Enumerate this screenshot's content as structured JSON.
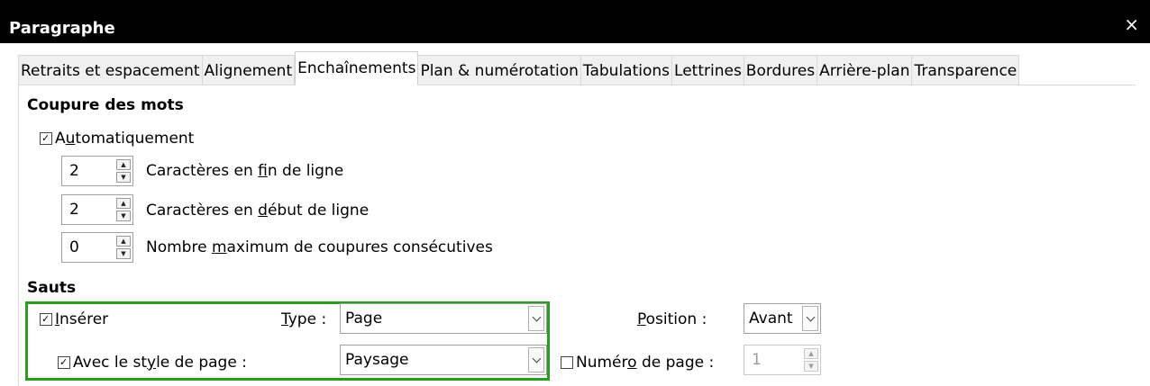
{
  "window": {
    "title": "Paragraphe",
    "close_glyph": "×"
  },
  "tabs": [
    {
      "label": "Retraits et espacement",
      "active": false
    },
    {
      "label": "Alignement",
      "active": false
    },
    {
      "label": "Enchaînements",
      "active": true
    },
    {
      "label": "Plan & numérotation",
      "active": false
    },
    {
      "label": "Tabulations",
      "active": false
    },
    {
      "label": "Lettrines",
      "active": false
    },
    {
      "label": "Bordures",
      "active": false
    },
    {
      "label": "Arrière-plan",
      "active": false
    },
    {
      "label": "Transparence",
      "active": false
    }
  ],
  "hyphenation": {
    "title": "Coupure des mots",
    "automatic": {
      "label_pre": "A",
      "label_u": "u",
      "label_post": "tomatiquement",
      "checked": true
    },
    "end_chars": {
      "value": "2",
      "label_pre": "Caractères en ",
      "label_u": "f",
      "label_post": "in de ligne"
    },
    "start_chars": {
      "value": "2",
      "label_pre": "Caractères en ",
      "label_u": "d",
      "label_post": "ébut de ligne"
    },
    "max_consecutive": {
      "value": "0",
      "label_pre": "Nombre ",
      "label_u": "m",
      "label_post": "aximum de coupures consécutives"
    }
  },
  "breaks": {
    "title": "Sauts",
    "insert": {
      "label_pre": "",
      "label_u": "I",
      "label_post": "nsérer",
      "checked": true
    },
    "type": {
      "label_u": "T",
      "label_post": "ype :",
      "value": "Page"
    },
    "position": {
      "label_u": "P",
      "label_post": "osition :",
      "value": "Avant"
    },
    "with_page_style": {
      "label_pre": "Avec le st",
      "label_u": "y",
      "label_post": "le de page :",
      "checked": true,
      "value": "Paysage"
    },
    "page_number": {
      "label_pre": "Numér",
      "label_u": "o",
      "label_post": " de page :",
      "checked": false,
      "value": "1"
    }
  },
  "highlight_color": "#2b9c1f"
}
